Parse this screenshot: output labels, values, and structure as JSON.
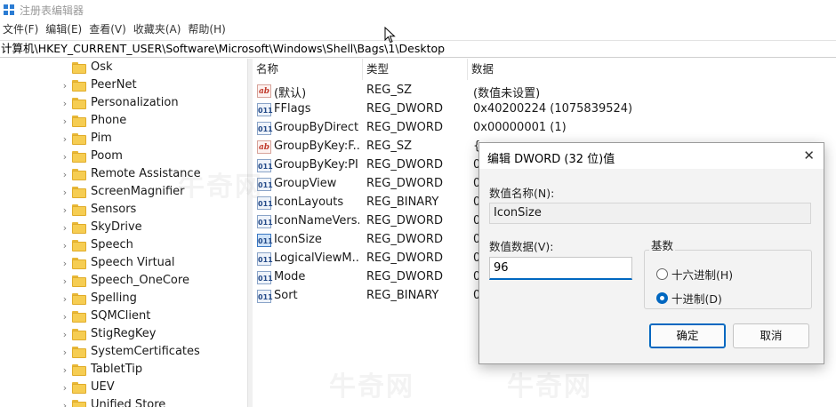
{
  "window": {
    "title": "注册表编辑器"
  },
  "menu": [
    "文件(F)",
    "编辑(E)",
    "查看(V)",
    "收藏夹(A)",
    "帮助(H)"
  ],
  "address": "计算机\\HKEY_CURRENT_USER\\Software\\Microsoft\\Windows\\Shell\\Bags\\1\\Desktop",
  "tree": [
    {
      "label": "Osk",
      "expander": false
    },
    {
      "label": "PeerNet",
      "expander": true
    },
    {
      "label": "Personalization",
      "expander": true
    },
    {
      "label": "Phone",
      "expander": true
    },
    {
      "label": "Pim",
      "expander": true
    },
    {
      "label": "Poom",
      "expander": true
    },
    {
      "label": "Remote Assistance",
      "expander": true
    },
    {
      "label": "ScreenMagnifier",
      "expander": true
    },
    {
      "label": "Sensors",
      "expander": true
    },
    {
      "label": "SkyDrive",
      "expander": true
    },
    {
      "label": "Speech",
      "expander": true
    },
    {
      "label": "Speech Virtual",
      "expander": true
    },
    {
      "label": "Speech_OneCore",
      "expander": true
    },
    {
      "label": "Spelling",
      "expander": true
    },
    {
      "label": "SQMClient",
      "expander": true
    },
    {
      "label": "StigRegKey",
      "expander": true
    },
    {
      "label": "SystemCertificates",
      "expander": true
    },
    {
      "label": "TabletTip",
      "expander": true
    },
    {
      "label": "UEV",
      "expander": true
    },
    {
      "label": "Unified Store",
      "expander": true
    }
  ],
  "columns": {
    "name": "名称",
    "type": "类型",
    "data": "数据"
  },
  "values": [
    {
      "icon": "ab",
      "name": "(默认)",
      "type": "REG_SZ",
      "data": "(数值未设置)"
    },
    {
      "icon": "011",
      "name": "FFlags",
      "type": "REG_DWORD",
      "data": "0x40200224 (1075839524)"
    },
    {
      "icon": "011",
      "name": "GroupByDirect...",
      "type": "REG_DWORD",
      "data": "0x00000001 (1)"
    },
    {
      "icon": "ab",
      "name": "GroupByKey:F...",
      "type": "REG_SZ",
      "data": "{"
    },
    {
      "icon": "011",
      "name": "GroupByKey:PID",
      "type": "REG_DWORD",
      "data": "0"
    },
    {
      "icon": "011",
      "name": "GroupView",
      "type": "REG_DWORD",
      "data": "0"
    },
    {
      "icon": "011",
      "name": "IconLayouts",
      "type": "REG_BINARY",
      "data": "0"
    },
    {
      "icon": "011",
      "name": "IconNameVers...",
      "type": "REG_DWORD",
      "data": "0"
    },
    {
      "icon": "011",
      "name": "IconSize",
      "type": "REG_DWORD",
      "data": "0"
    },
    {
      "icon": "011",
      "name": "LogicalViewM...",
      "type": "REG_DWORD",
      "data": "0"
    },
    {
      "icon": "011",
      "name": "Mode",
      "type": "REG_DWORD",
      "data": "0"
    },
    {
      "icon": "011",
      "name": "Sort",
      "type": "REG_BINARY",
      "data": "0"
    }
  ],
  "dialog": {
    "title": "编辑 DWORD (32 位)值",
    "close": "✕",
    "name_label": "数值名称(N):",
    "name_value": "IconSize",
    "data_label": "数值数据(V):",
    "data_value": "96",
    "base_label": "基数",
    "radio_hex": "十六进制(H)",
    "radio_dec": "十进制(D)",
    "ok": "确定",
    "cancel": "取消"
  },
  "watermark": "牛奇网"
}
